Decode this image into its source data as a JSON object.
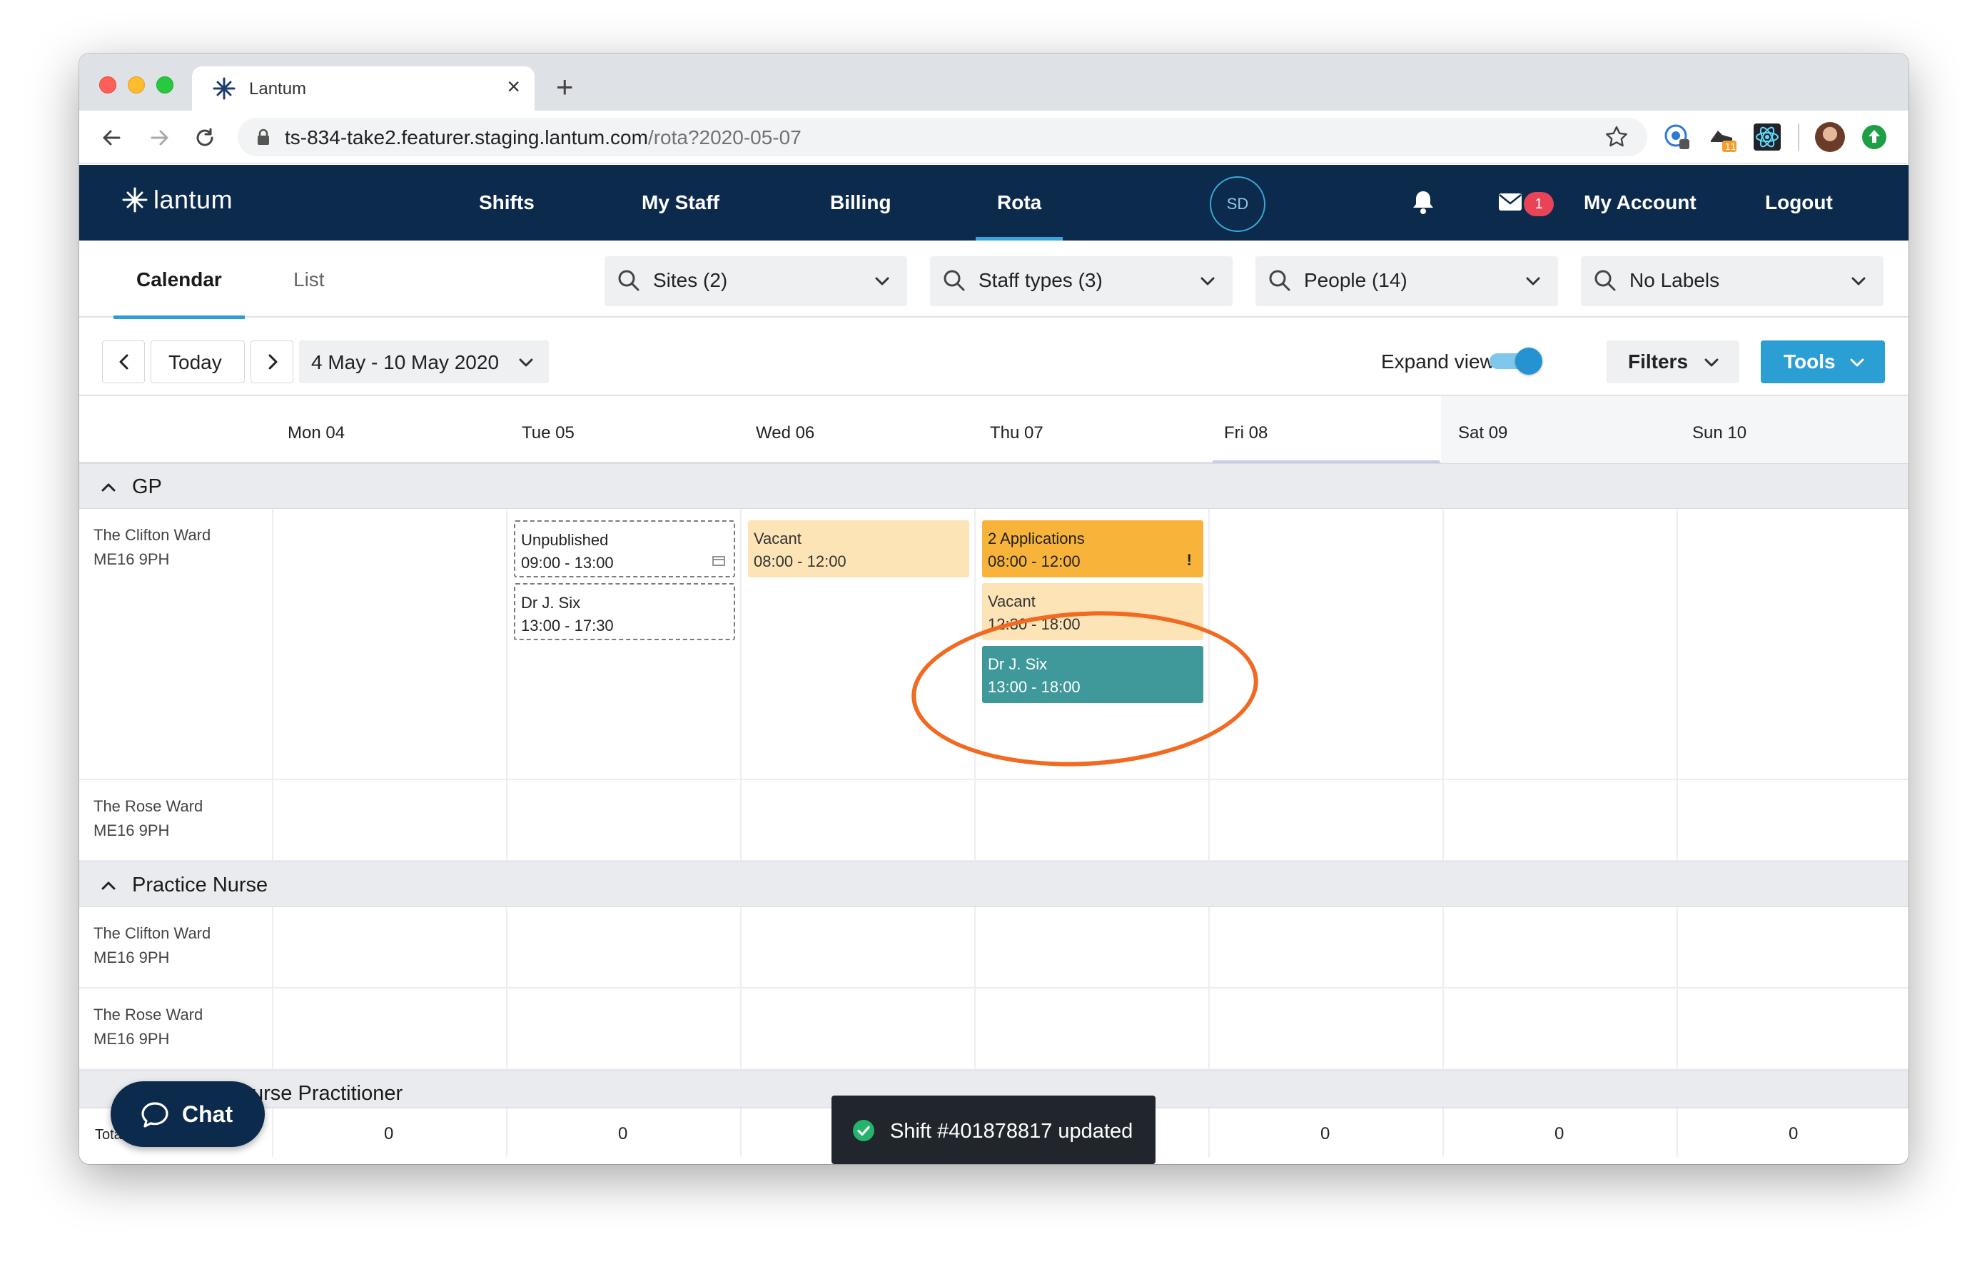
{
  "browser": {
    "tab_title": "Lantum",
    "url_host": "ts-834-take2.featurer.staging.lantum.com",
    "url_path": "/rota?2020-05-07"
  },
  "nav": {
    "logo_text": "lantum",
    "links": [
      "Shifts",
      "My Staff",
      "Billing",
      "Rota"
    ],
    "active_link": "Rota",
    "avatar_initials": "SD",
    "mail_badge": "1",
    "account": "My Account",
    "logout": "Logout"
  },
  "subnav": {
    "tabs": [
      "Calendar",
      "List"
    ],
    "filters": [
      "Sites (2)",
      "Staff types (3)",
      "People (14)",
      "No Labels"
    ]
  },
  "controls": {
    "today": "Today",
    "date_range": "4 May - 10 May 2020",
    "expand_view": "Expand view",
    "filters": "Filters",
    "tools": "Tools"
  },
  "days": [
    "Mon 04",
    "Tue 05",
    "Wed 06",
    "Thu 07",
    "Fri 08",
    "Sat 09",
    "Sun 10"
  ],
  "sections": {
    "gp": "GP",
    "practice_nurse": "Practice Nurse",
    "nurse_practitioner": "urse Practitioner"
  },
  "rows": {
    "gp_clifton": {
      "name": "The Clifton Ward",
      "postcode": "ME16 9PH"
    },
    "gp_rose": {
      "name": "The Rose Ward",
      "postcode": "ME16 9PH"
    },
    "pn_clifton": {
      "name": "The Clifton Ward",
      "postcode": "ME16 9PH"
    },
    "pn_rose": {
      "name": "The Rose Ward",
      "postcode": "ME16 9PH"
    }
  },
  "shifts": {
    "tue_1": {
      "title": "Unpublished",
      "time": "09:00 - 13:00"
    },
    "tue_2": {
      "title": "Dr J. Six",
      "time": "13:00 - 17:30"
    },
    "wed_1": {
      "title": "Vacant",
      "time": "08:00 - 12:00"
    },
    "thu_1": {
      "title": "2 Applications",
      "time": "08:00 - 12:00",
      "flag": "!"
    },
    "thu_2": {
      "title": "Vacant",
      "time": "12:30 - 18:00"
    },
    "thu_3": {
      "title": "Dr J. Six",
      "time": "13:00 - 18:00"
    }
  },
  "totals": {
    "label": "Total Staff",
    "values": [
      "0",
      "0",
      "0",
      "0",
      "0"
    ]
  },
  "chat_label": "Chat",
  "toast": "Shift #401878817 updated",
  "colors": {
    "navbar": "#0c2a4c",
    "accent": "#2b9fd4",
    "vacant": "#fde4b7",
    "applications": "#f8b33a",
    "filled": "#3f999b",
    "annotation_circle": "#f26a21"
  }
}
